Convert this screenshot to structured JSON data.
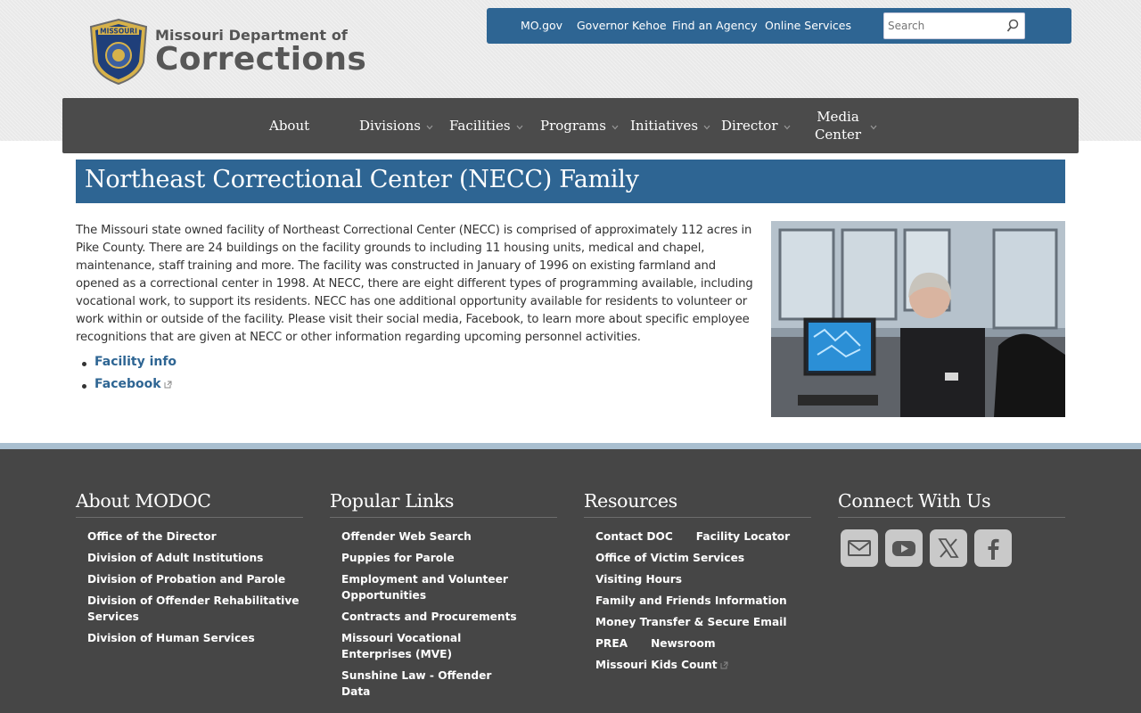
{
  "header": {
    "logo_line1": "Missouri Department of",
    "logo_line2": "Corrections",
    "seal_text": "MISSOURI DEPARTMENT OF CORRECTIONS",
    "utility_links": [
      "MO.gov",
      "Governor Kehoe",
      "Find an Agency",
      "Online Services"
    ],
    "search_placeholder": "Search"
  },
  "nav": {
    "items": [
      "About",
      "Divisions",
      "Facilities",
      "Programs",
      "Initiatives",
      "Director",
      "Media Center"
    ]
  },
  "main": {
    "title": "Northeast Correctional Center (NECC) Family",
    "paragraph": "The Missouri state owned facility of Northeast Correctional Center (NECC) is comprised of approximately 112 acres in Pike County. There are 24 buildings on the facility grounds to including 11 housing units, medical and chapel, maintenance, staff training and more.  The facility was constructed in January of 1996 on existing farmland and opened as a correctional center in 1998. At NECC, there are eight different types of programming available, including vocational work, to support its residents. NECC has one additional opportunity available for residents to volunteer or work within or outside of the facility. Please visit their social media, Facebook, to learn more about specific employee recognitions that are given at NECC or other information regarding upcoming personnel activities.",
    "links": [
      "Facility info",
      "Facebook"
    ]
  },
  "footer": {
    "about": {
      "heading": "About MODOC",
      "items": [
        "Office of the Director",
        "Division of Adult Institutions",
        "Division of Probation and Parole",
        "Division of Offender Rehabilitative Services",
        "Division of Human Services"
      ]
    },
    "popular": {
      "heading": "Popular Links",
      "items": [
        "Offender Web Search",
        "Puppies for Parole",
        "Employment and Volunteer Opportunities",
        "Contracts and Procurements",
        "Missouri Vocational Enterprises (MVE)",
        "Sunshine Law - Offender Data"
      ]
    },
    "resources": {
      "heading": "Resources",
      "items": [
        "Contact DOC",
        "Facility Locator",
        "Office of Victim Services",
        "Visiting Hours",
        "Family and Friends Information",
        "Money Transfer & Secure Email",
        "PREA",
        "Newsroom",
        "Missouri Kids Count"
      ]
    },
    "connect": {
      "heading": "Connect With Us",
      "icons": [
        "email-icon",
        "youtube-icon",
        "x-icon",
        "facebook-icon"
      ]
    }
  },
  "colors": {
    "brand_blue": "#2e6593",
    "nav_gray": "#4b4b4b",
    "footer_gray": "#464646"
  }
}
